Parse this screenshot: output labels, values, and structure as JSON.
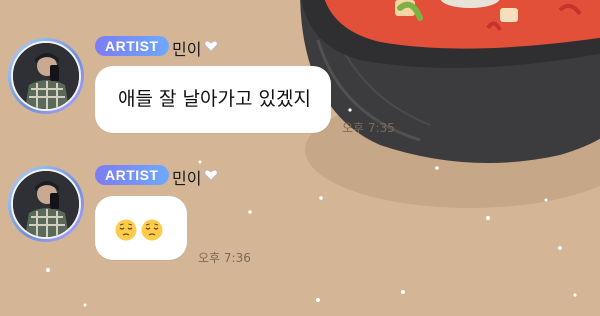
{
  "chat": {
    "messages": [
      {
        "badge": "ARTIST",
        "sender": "민이",
        "text": "애들 잘 날아가고 있겠지",
        "time": "오후 7:35"
      },
      {
        "badge": "ARTIST",
        "sender": "민이",
        "emoji": [
          "pensive-face",
          "pensive-face"
        ],
        "time": "오후 7:36"
      }
    ]
  },
  "colors": {
    "background": "#d4b596",
    "badge_gradient_start": "#7c7cf2",
    "badge_gradient_end": "#6fa8ff",
    "bubble": "#ffffff",
    "pot": "#3d3d3f",
    "stew": "#e8503a"
  }
}
